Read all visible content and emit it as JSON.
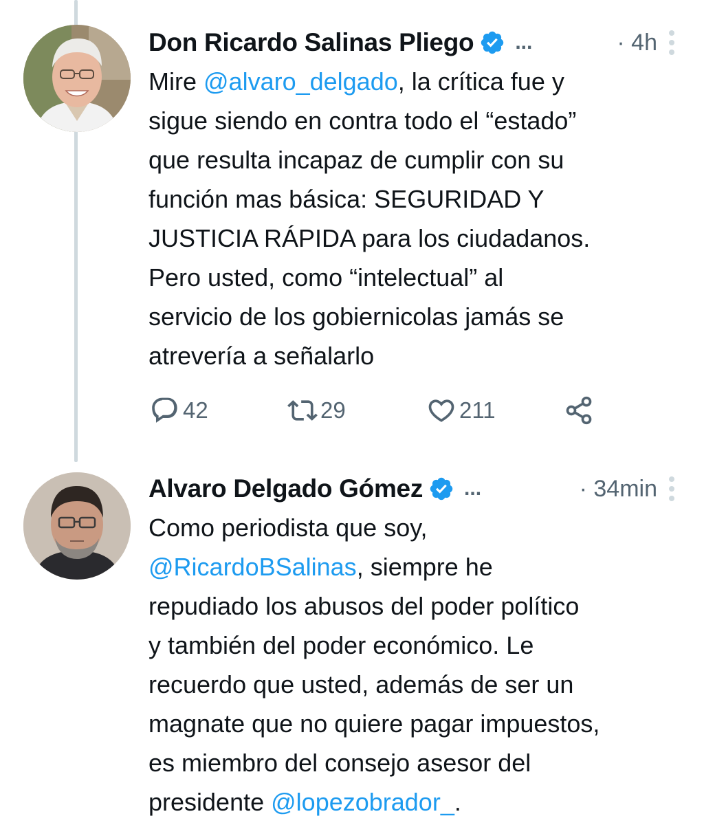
{
  "tweets": [
    {
      "author": {
        "display_name": "Don Ricardo Salinas Pliego",
        "verified": true,
        "name_ellipsis": "..."
      },
      "timestamp": "· 4h",
      "text_parts": [
        {
          "text": "Mire ",
          "mention": false
        },
        {
          "text": "@alvaro_delgado",
          "mention": true
        },
        {
          "text": ", la crítica fue y\nsigue siendo en contra todo el “estado”\nque resulta incapaz de cumplir con su\nfunción mas básica: SEGURIDAD Y\nJUSTICIA RÁPIDA para los ciudadanos.\nPero usted, como “intelectual” al\nservicio de los gobiernicolas jamás se\natrevería a señalarlo",
          "mention": false
        }
      ],
      "actions": {
        "replies": "42",
        "retweets": "29",
        "likes": "211"
      }
    },
    {
      "author": {
        "display_name": "Alvaro Delgado Gómez",
        "verified": true,
        "name_ellipsis": "..."
      },
      "timestamp": "· 34min",
      "text_parts": [
        {
          "text": "Como periodista que soy,\n",
          "mention": false
        },
        {
          "text": "@RicardoBSalinas",
          "mention": true
        },
        {
          "text": ", siempre he\nrepudiado los abusos del poder político\ny también del poder económico. Le\nrecuerdo que usted, además de ser un\nmagnate que no quiere pagar impuestos,\nes miembro del consejo asesor del\npresidente ",
          "mention": false
        },
        {
          "text": "@lopezobrador_",
          "mention": true
        },
        {
          "text": ".",
          "mention": false
        }
      ]
    }
  ],
  "colors": {
    "accent": "#1d9bf0",
    "secondary_text": "#536471",
    "thread_line": "#cfd9de"
  },
  "icons": {
    "verified": "verified-badge-icon",
    "more": "more-vertical-icon",
    "reply": "reply-icon",
    "retweet": "retweet-icon",
    "like": "heart-icon",
    "share": "share-icon"
  }
}
